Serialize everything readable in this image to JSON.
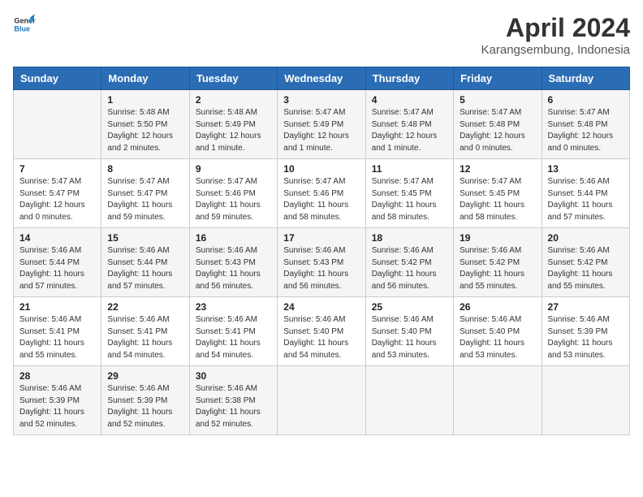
{
  "header": {
    "logo_general": "General",
    "logo_blue": "Blue",
    "month_title": "April 2024",
    "location": "Karangsembung, Indonesia"
  },
  "columns": [
    "Sunday",
    "Monday",
    "Tuesday",
    "Wednesday",
    "Thursday",
    "Friday",
    "Saturday"
  ],
  "weeks": [
    [
      {
        "day": "",
        "detail": ""
      },
      {
        "day": "1",
        "detail": "Sunrise: 5:48 AM\nSunset: 5:50 PM\nDaylight: 12 hours\nand 2 minutes."
      },
      {
        "day": "2",
        "detail": "Sunrise: 5:48 AM\nSunset: 5:49 PM\nDaylight: 12 hours\nand 1 minute."
      },
      {
        "day": "3",
        "detail": "Sunrise: 5:47 AM\nSunset: 5:49 PM\nDaylight: 12 hours\nand 1 minute."
      },
      {
        "day": "4",
        "detail": "Sunrise: 5:47 AM\nSunset: 5:48 PM\nDaylight: 12 hours\nand 1 minute."
      },
      {
        "day": "5",
        "detail": "Sunrise: 5:47 AM\nSunset: 5:48 PM\nDaylight: 12 hours\nand 0 minutes."
      },
      {
        "day": "6",
        "detail": "Sunrise: 5:47 AM\nSunset: 5:48 PM\nDaylight: 12 hours\nand 0 minutes."
      }
    ],
    [
      {
        "day": "7",
        "detail": "Sunrise: 5:47 AM\nSunset: 5:47 PM\nDaylight: 12 hours\nand 0 minutes."
      },
      {
        "day": "8",
        "detail": "Sunrise: 5:47 AM\nSunset: 5:47 PM\nDaylight: 11 hours\nand 59 minutes."
      },
      {
        "day": "9",
        "detail": "Sunrise: 5:47 AM\nSunset: 5:46 PM\nDaylight: 11 hours\nand 59 minutes."
      },
      {
        "day": "10",
        "detail": "Sunrise: 5:47 AM\nSunset: 5:46 PM\nDaylight: 11 hours\nand 58 minutes."
      },
      {
        "day": "11",
        "detail": "Sunrise: 5:47 AM\nSunset: 5:45 PM\nDaylight: 11 hours\nand 58 minutes."
      },
      {
        "day": "12",
        "detail": "Sunrise: 5:47 AM\nSunset: 5:45 PM\nDaylight: 11 hours\nand 58 minutes."
      },
      {
        "day": "13",
        "detail": "Sunrise: 5:46 AM\nSunset: 5:44 PM\nDaylight: 11 hours\nand 57 minutes."
      }
    ],
    [
      {
        "day": "14",
        "detail": "Sunrise: 5:46 AM\nSunset: 5:44 PM\nDaylight: 11 hours\nand 57 minutes."
      },
      {
        "day": "15",
        "detail": "Sunrise: 5:46 AM\nSunset: 5:44 PM\nDaylight: 11 hours\nand 57 minutes."
      },
      {
        "day": "16",
        "detail": "Sunrise: 5:46 AM\nSunset: 5:43 PM\nDaylight: 11 hours\nand 56 minutes."
      },
      {
        "day": "17",
        "detail": "Sunrise: 5:46 AM\nSunset: 5:43 PM\nDaylight: 11 hours\nand 56 minutes."
      },
      {
        "day": "18",
        "detail": "Sunrise: 5:46 AM\nSunset: 5:42 PM\nDaylight: 11 hours\nand 56 minutes."
      },
      {
        "day": "19",
        "detail": "Sunrise: 5:46 AM\nSunset: 5:42 PM\nDaylight: 11 hours\nand 55 minutes."
      },
      {
        "day": "20",
        "detail": "Sunrise: 5:46 AM\nSunset: 5:42 PM\nDaylight: 11 hours\nand 55 minutes."
      }
    ],
    [
      {
        "day": "21",
        "detail": "Sunrise: 5:46 AM\nSunset: 5:41 PM\nDaylight: 11 hours\nand 55 minutes."
      },
      {
        "day": "22",
        "detail": "Sunrise: 5:46 AM\nSunset: 5:41 PM\nDaylight: 11 hours\nand 54 minutes."
      },
      {
        "day": "23",
        "detail": "Sunrise: 5:46 AM\nSunset: 5:41 PM\nDaylight: 11 hours\nand 54 minutes."
      },
      {
        "day": "24",
        "detail": "Sunrise: 5:46 AM\nSunset: 5:40 PM\nDaylight: 11 hours\nand 54 minutes."
      },
      {
        "day": "25",
        "detail": "Sunrise: 5:46 AM\nSunset: 5:40 PM\nDaylight: 11 hours\nand 53 minutes."
      },
      {
        "day": "26",
        "detail": "Sunrise: 5:46 AM\nSunset: 5:40 PM\nDaylight: 11 hours\nand 53 minutes."
      },
      {
        "day": "27",
        "detail": "Sunrise: 5:46 AM\nSunset: 5:39 PM\nDaylight: 11 hours\nand 53 minutes."
      }
    ],
    [
      {
        "day": "28",
        "detail": "Sunrise: 5:46 AM\nSunset: 5:39 PM\nDaylight: 11 hours\nand 52 minutes."
      },
      {
        "day": "29",
        "detail": "Sunrise: 5:46 AM\nSunset: 5:39 PM\nDaylight: 11 hours\nand 52 minutes."
      },
      {
        "day": "30",
        "detail": "Sunrise: 5:46 AM\nSunset: 5:38 PM\nDaylight: 11 hours\nand 52 minutes."
      },
      {
        "day": "",
        "detail": ""
      },
      {
        "day": "",
        "detail": ""
      },
      {
        "day": "",
        "detail": ""
      },
      {
        "day": "",
        "detail": ""
      }
    ]
  ]
}
